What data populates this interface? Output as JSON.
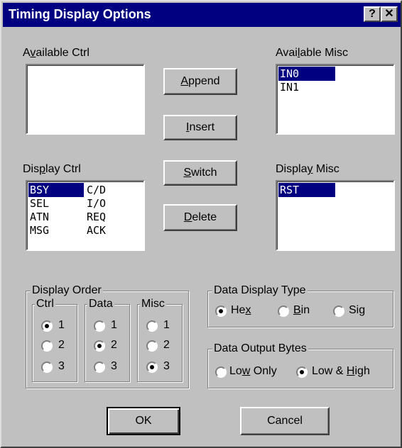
{
  "window": {
    "title": "Timing Display Options",
    "help_glyph": "?",
    "close_glyph": "✕"
  },
  "available_ctrl": {
    "label_pre": "A",
    "label_key": "v",
    "label_post": "ailable Ctrl",
    "items": []
  },
  "available_misc": {
    "label_pre": "Avai",
    "label_key": "l",
    "label_post": "able Misc",
    "items": [
      "IN0",
      "IN1"
    ],
    "selected": "IN0"
  },
  "display_ctrl": {
    "label_pre": "Dis",
    "label_key": "p",
    "label_post": "lay Ctrl",
    "col1": [
      "BSY",
      "SEL",
      "ATN",
      "MSG"
    ],
    "col2": [
      "C/D",
      "I/O",
      "REQ",
      "ACK"
    ],
    "selected": "BSY"
  },
  "display_misc": {
    "label_pre": "Displa",
    "label_key": "y",
    "label_post": " Misc",
    "items": [
      "RST"
    ],
    "selected": "RST"
  },
  "buttons": {
    "append": {
      "key": "A",
      "rest": "ppend"
    },
    "insert": {
      "key": "I",
      "rest": "nsert"
    },
    "switch": {
      "key": "S",
      "rest": "witch"
    },
    "delete": {
      "key": "D",
      "rest": "elete"
    },
    "ok": "OK",
    "cancel": "Cancel"
  },
  "display_order": {
    "title": "Display Order",
    "ctrl": {
      "title": "Ctrl",
      "options": [
        "1",
        "2",
        "3"
      ],
      "selected": "1"
    },
    "data": {
      "title": "Data",
      "options": [
        "1",
        "2",
        "3"
      ],
      "selected": "2"
    },
    "misc": {
      "title": "Misc",
      "options": [
        "1",
        "2",
        "3"
      ],
      "selected": "3"
    }
  },
  "data_display_type": {
    "title": "Data Display Type",
    "hex": {
      "pre": "He",
      "key": "x",
      "post": ""
    },
    "bin": {
      "pre": "",
      "key": "B",
      "post": "in"
    },
    "sig": {
      "pre": "Si",
      "key": "g",
      "post": ""
    },
    "selected": "Hex"
  },
  "data_output_bytes": {
    "title": "Data Output Bytes",
    "low_only": {
      "pre": "Lo",
      "key": "w",
      "post": " Only"
    },
    "low_high": {
      "pre": "Low & ",
      "key": "H",
      "post": "igh"
    },
    "selected": "Low & High"
  }
}
